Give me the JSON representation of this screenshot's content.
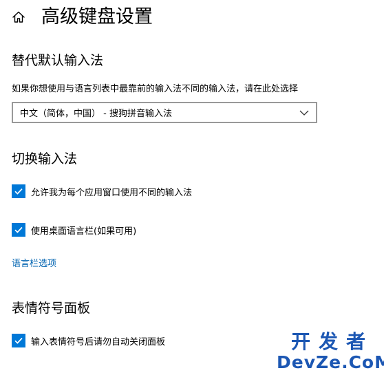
{
  "header": {
    "home_icon": "home-icon",
    "title": "高级键盘设置"
  },
  "override_section": {
    "heading": "替代默认输入法",
    "description": "如果你想使用与语言列表中最靠前的输入法不同的输入法，请在此处选择",
    "select": {
      "selected_value": "中文（简体，中国） - 搜狗拼音输入法",
      "chevron_icon": "chevron-down-icon"
    }
  },
  "switch_section": {
    "heading": "切换输入法",
    "options": [
      {
        "label": "允许我为每个应用窗口使用不同的输入法",
        "checked": true
      },
      {
        "label": "使用桌面语言栏(如果可用)",
        "checked": true
      }
    ],
    "language_bar_link": "语言栏选项"
  },
  "emoji_section": {
    "heading": "表情符号面板",
    "options": [
      {
        "label": "输入表情符号后请勿自动关闭面板",
        "checked": true
      }
    ]
  },
  "watermark": {
    "line1": "开发者",
    "line2": "DevZe.CoM"
  },
  "colors": {
    "accent": "#0078d7",
    "link": "#0063b1",
    "watermark": "#1c57b3"
  }
}
